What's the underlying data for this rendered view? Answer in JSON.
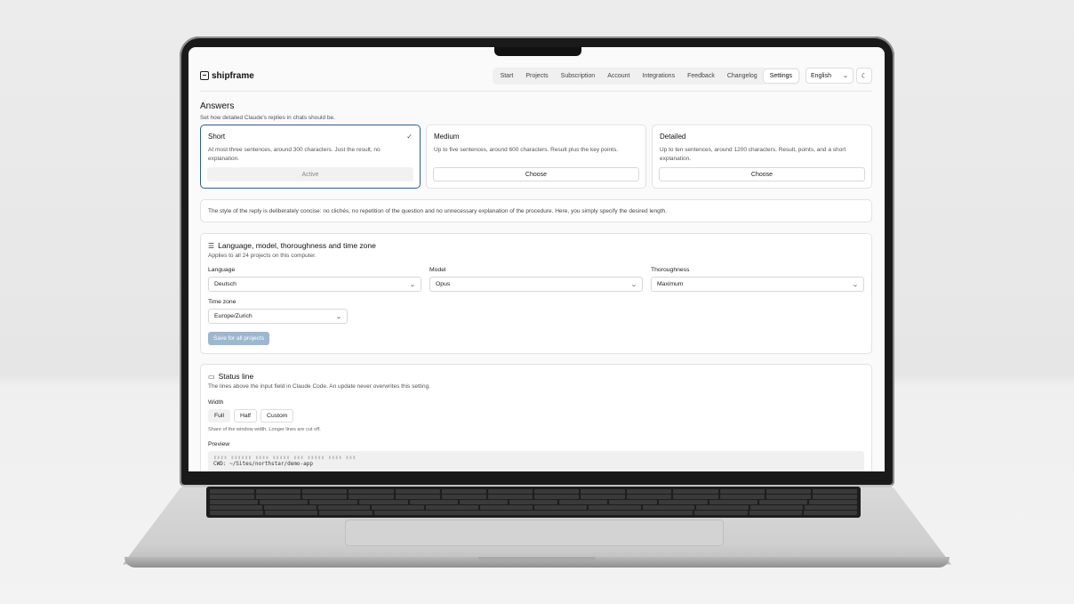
{
  "app": {
    "logo": "shipframe",
    "nav": [
      "Start",
      "Projects",
      "Subscription",
      "Account",
      "Integrations",
      "Feedback",
      "Changelog",
      "Settings"
    ],
    "active_nav": "Settings",
    "language": "English",
    "theme_icon": "moon-icon"
  },
  "answers": {
    "title": "Answers",
    "subtitle": "Set how detailed Claude's replies in chats should be.",
    "cards": [
      {
        "title": "Short",
        "desc": "At most three sentences, around 300 characters. Just the result, no explanation.",
        "button": "Active"
      },
      {
        "title": "Medium",
        "desc": "Up to five sentences, around 600 characters. Result plus the key points.",
        "button": "Choose"
      },
      {
        "title": "Detailed",
        "desc": "Up to ten sentences, around 1200 characters. Result, points, and a short explanation.",
        "button": "Choose"
      }
    ],
    "note": "The style of the reply is deliberately concise: no clichés, no repetition of the question and no unnecessary explanation of the procedure. Here, you simply specify the desired length."
  },
  "settings_panel": {
    "title": "Language, model, thoroughness and time zone",
    "subtitle": "Applies to all 24 projects on this computer.",
    "language_label": "Language",
    "language_value": "Deutsch",
    "model_label": "Model",
    "model_value": "Opus",
    "thoroughness_label": "Thoroughness",
    "thoroughness_value": "Maximum",
    "timezone_label": "Time zone",
    "timezone_value": "Europe/Zurich",
    "save_button": "Save for all projects"
  },
  "status_line": {
    "title": "Status line",
    "subtitle": "The lines above the input field in Claude Code. An update never overwrites this setting.",
    "width_label": "Width",
    "width_options": [
      "Full",
      "Half",
      "Custom"
    ],
    "width_selected": "Full",
    "width_hint": "Share of the window width. Longer lines are cut off.",
    "preview_label": "Preview",
    "preview_line2_key": "CWD:",
    "preview_line2_value": "~/Sites/northstar/demo-app"
  }
}
